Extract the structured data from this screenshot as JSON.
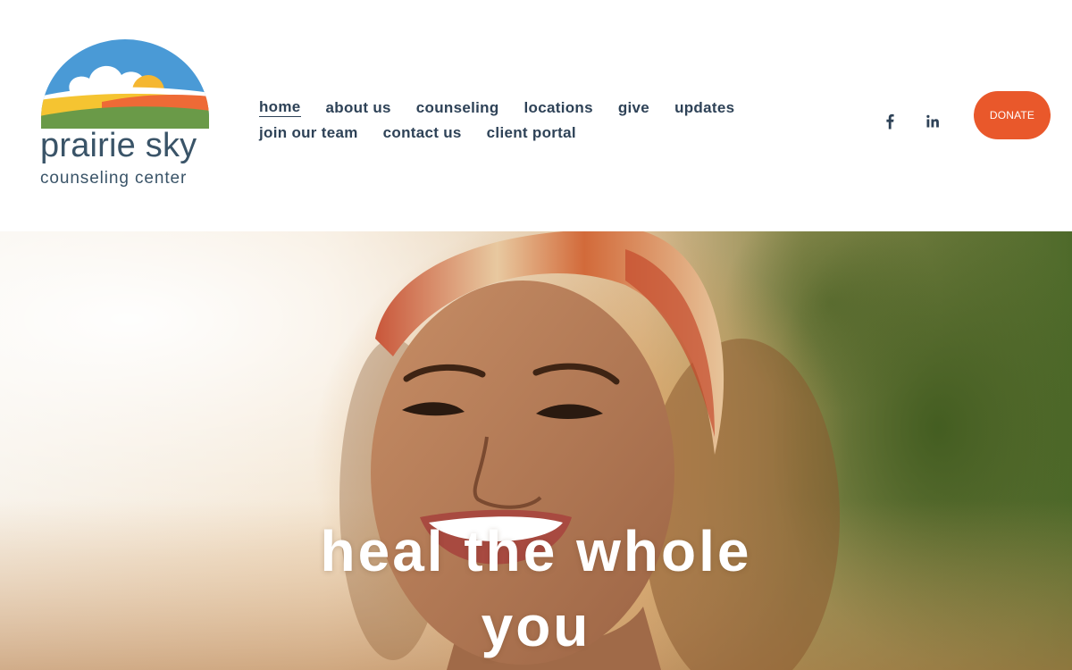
{
  "brand": {
    "name": "prairie sky",
    "tagline": "counseling center",
    "logo_icon": "prairie-sky-landscape-logo",
    "colors": {
      "sky": "#4a9ad6",
      "sun": "#f5b731",
      "field_orange": "#ee6a36",
      "field_green": "#6a9a48",
      "text": "#3a5468"
    }
  },
  "nav": {
    "row1": [
      "home",
      "about us",
      "counseling",
      "locations",
      "give",
      "updates"
    ],
    "row2": [
      "join our team",
      "contact us",
      "client portal"
    ],
    "active": "home"
  },
  "social": {
    "facebook_icon": "facebook-icon",
    "linkedin_icon": "linkedin-icon"
  },
  "donate": {
    "label": "DONATE",
    "color": "#e9582b"
  },
  "hero": {
    "heading": "heal the whole you",
    "image": "smiling-woman-with-headscarf-outdoors-in-sunlight"
  }
}
